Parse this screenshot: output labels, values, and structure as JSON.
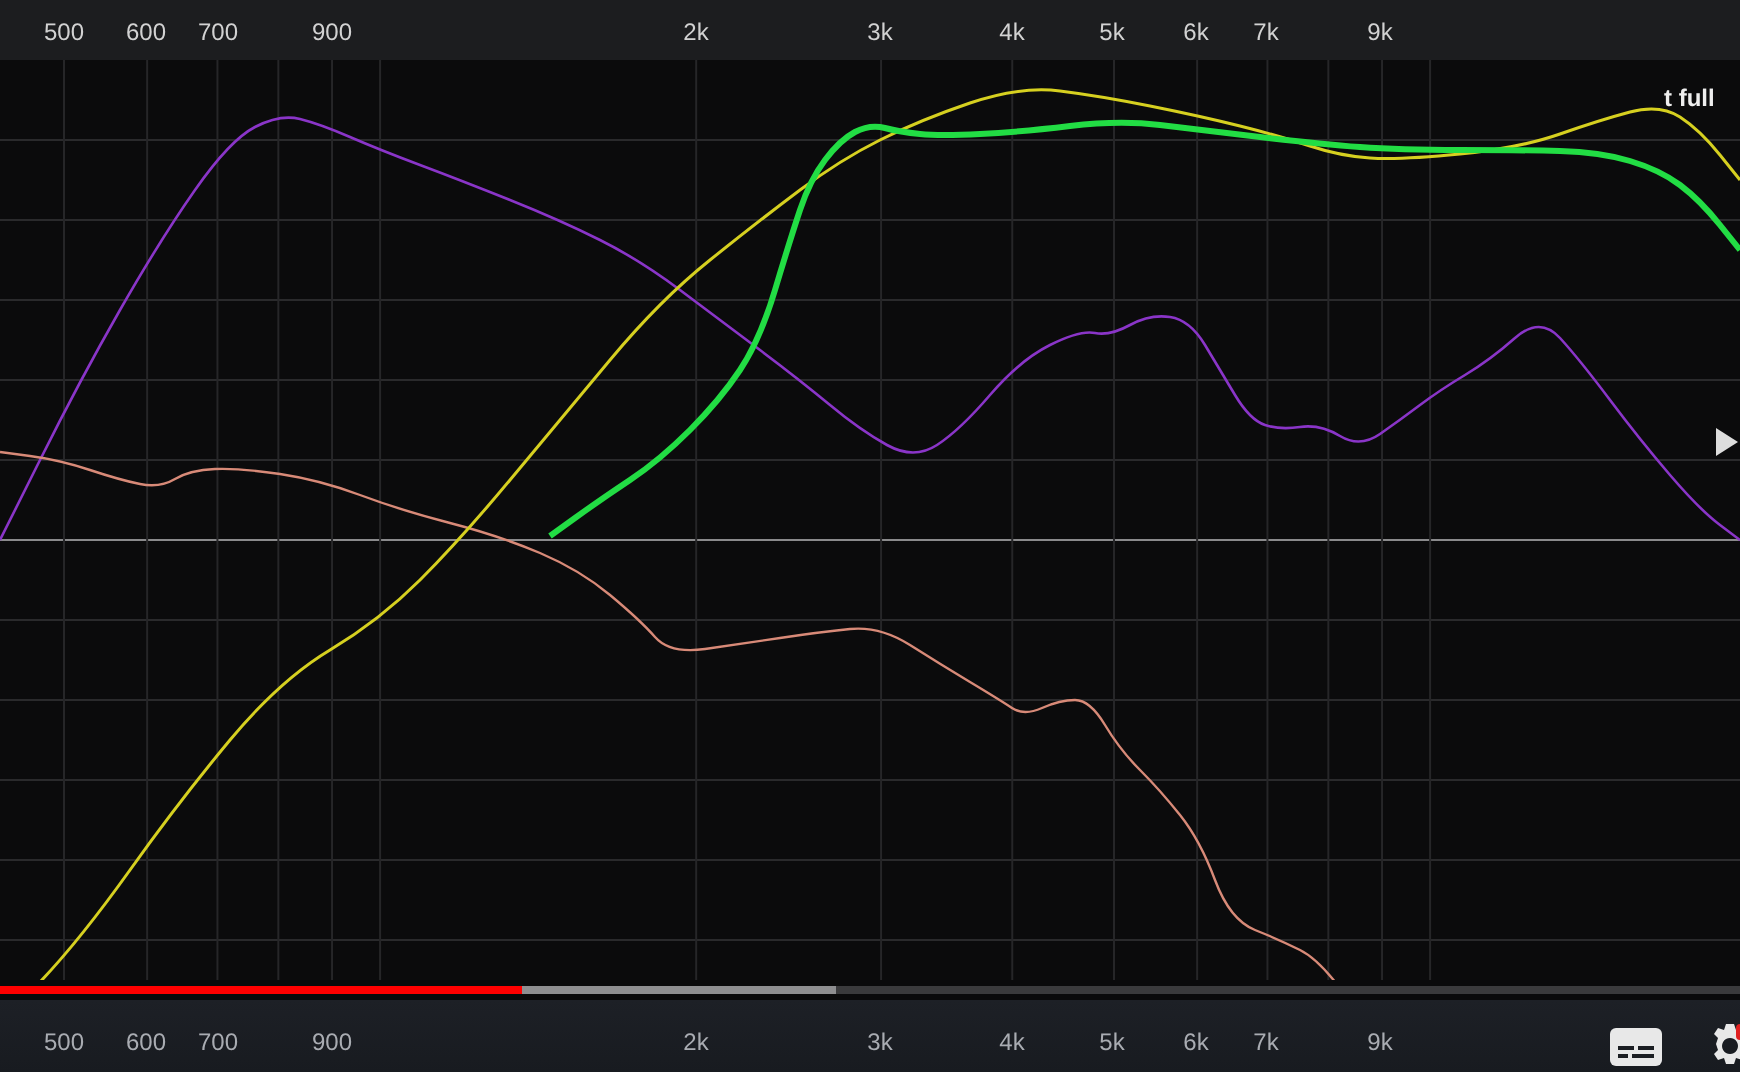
{
  "top_axis": {
    "labels": [
      "500",
      "600",
      "700",
      "900",
      "2k",
      "3k",
      "4k",
      "5k",
      "6k",
      "7k",
      "9k"
    ]
  },
  "plot": {
    "legend_text": "t full"
  },
  "progress": {
    "played": {
      "level": 0.3
    },
    "buffered": {
      "level": 0.48
    }
  },
  "bottom_axis": {
    "labels": [
      "500",
      "600",
      "700",
      "900",
      "2k",
      "3k",
      "4k",
      "5k",
      "6k",
      "7k",
      "9k"
    ]
  }
}
